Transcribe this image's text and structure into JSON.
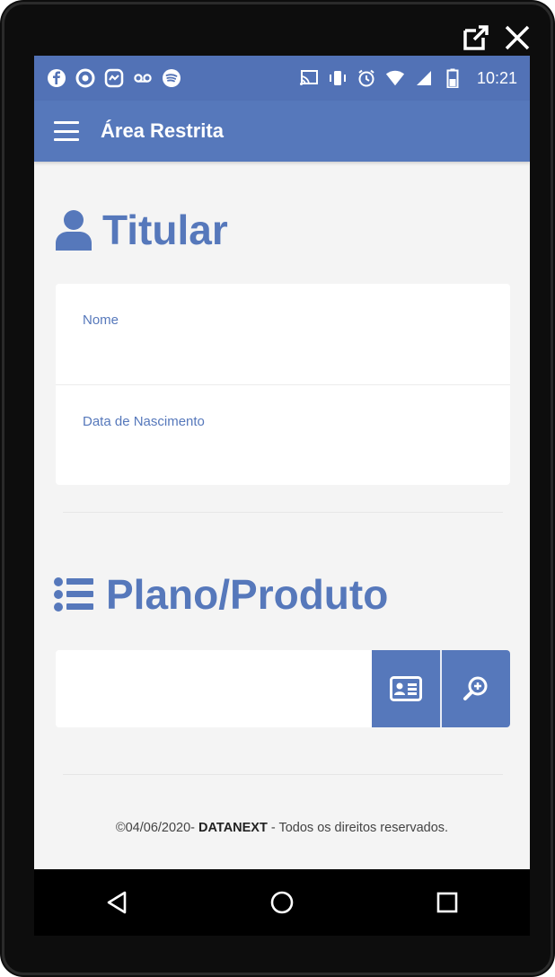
{
  "statusbar": {
    "time": "10:21",
    "icons_left": [
      "facebook-icon",
      "eye-icon",
      "messenger-icon",
      "voicemail-icon",
      "spotify-icon"
    ],
    "icons_right": [
      "cast-icon",
      "vibrate-icon",
      "alarm-icon",
      "wifi-icon",
      "signal-icon",
      "battery-icon"
    ]
  },
  "appbar": {
    "title": "Área Restrita"
  },
  "titular": {
    "heading": "Titular",
    "fields": [
      {
        "label": "Nome"
      },
      {
        "label": "Data de Nascimento"
      }
    ]
  },
  "plano": {
    "heading": "Plano/Produto",
    "input_value": ""
  },
  "footer": {
    "date_prefix": "©04/06/2020- ",
    "company": "DATANEXT",
    "suffix": " - Todos os direitos reservados."
  },
  "colors": {
    "primary": "#5678bb",
    "statusbar": "#5272b6",
    "background": "#f4f4f4"
  }
}
